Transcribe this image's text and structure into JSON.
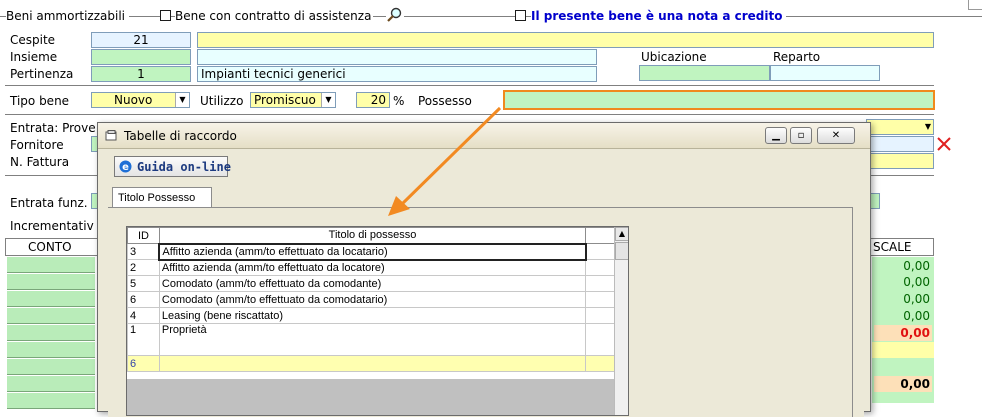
{
  "header": {
    "beni_label": "Beni ammortizzabili",
    "contratto_label": "Bene con contratto di assistenza",
    "nota_credito_label": "Il presente bene è una nota a credito"
  },
  "fields": {
    "cespite_label": "Cespite",
    "cespite_value": "21",
    "insieme_label": "Insieme",
    "pertinenza_label": "Pertinenza",
    "pertinenza_value": "1",
    "pertinenza_desc": "Impianti tecnici generici",
    "ubicazione_label": "Ubicazione",
    "reparto_label": "Reparto",
    "tipo_bene_label": "Tipo bene",
    "tipo_bene_value": "Nuovo",
    "utilizzo_label": "Utilizzo",
    "utilizzo_value": "Promiscuo",
    "percent_value": "20",
    "percent_sign": "%",
    "possesso_label": "Possesso",
    "entrata_label": "Entrata: Prove",
    "fornitore_label": "Fornitore",
    "nfattura_label": "N. Fattura",
    "entrata_funz_label": "Entrata funz.",
    "incrementativ_label": "Incrementativ",
    "conto_header": "CONTO",
    "scale_header": "SCALE"
  },
  "values_column": [
    "0,00",
    "0,00",
    "0,00",
    "0,00",
    "0,00",
    "0,00"
  ],
  "modal": {
    "title": "Tabelle di raccordo",
    "help_button": "Guida on-line",
    "tab_label": "Titolo Possesso",
    "grid": {
      "col_id": "ID",
      "col_title": "Titolo di possesso",
      "rows": [
        {
          "id": "3",
          "title": "Affitto azienda (amm/to effettuato da locatario)"
        },
        {
          "id": "2",
          "title": "Affitto azienda (amm/to effettuato da locatore)"
        },
        {
          "id": "5",
          "title": "Comodato (amm/to effettuato da comodante)"
        },
        {
          "id": "6",
          "title": "Comodato (amm/to effettuato da comodatario)"
        },
        {
          "id": "4",
          "title": "Leasing (bene riscattato)"
        },
        {
          "id": "1",
          "title": "Proprietà"
        }
      ],
      "new_row_id": "6"
    }
  },
  "colors": {
    "highlight": "#f08a1c",
    "arrow": "#f28a22",
    "blue_text": "#0000cc",
    "close_x": "#e02020"
  }
}
